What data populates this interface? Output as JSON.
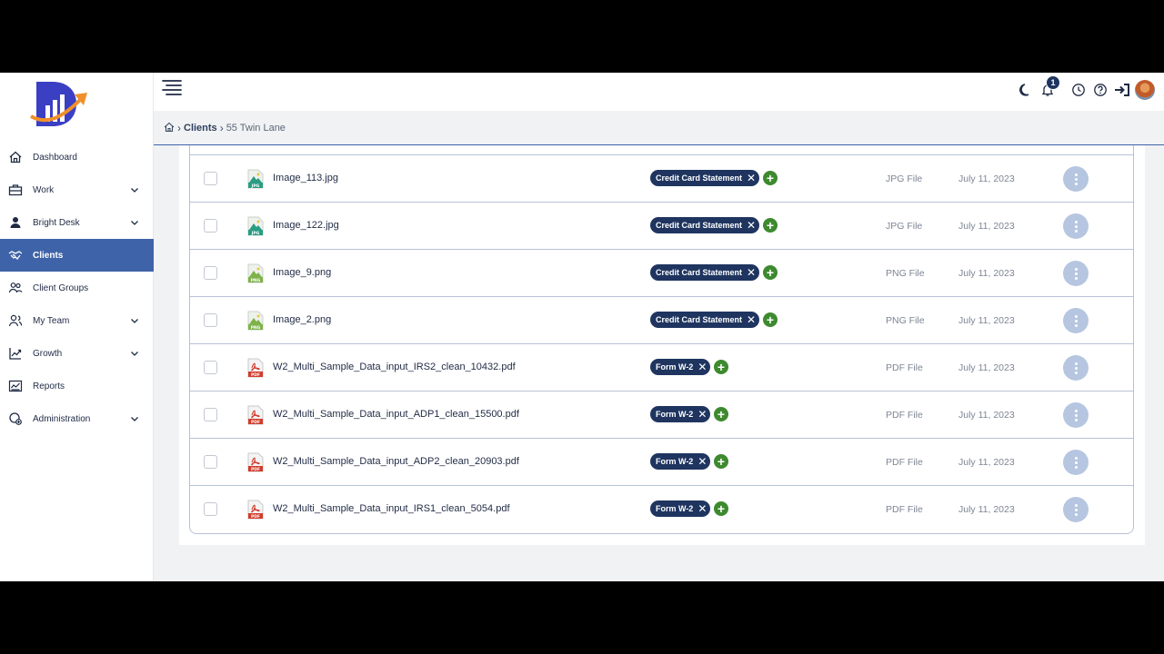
{
  "sidebar": {
    "items": [
      {
        "label": "Dashboard",
        "icon": "home-icon",
        "has_chevron": false,
        "active": false
      },
      {
        "label": "Work",
        "icon": "briefcase-icon",
        "has_chevron": true,
        "active": false
      },
      {
        "label": "Bright Desk",
        "icon": "user-desk-icon",
        "has_chevron": true,
        "active": false
      },
      {
        "label": "Clients",
        "icon": "handshake-icon",
        "has_chevron": false,
        "active": true
      },
      {
        "label": "Client Groups",
        "icon": "users-icon",
        "has_chevron": false,
        "active": false
      },
      {
        "label": "My Team",
        "icon": "team-icon",
        "has_chevron": true,
        "active": false
      },
      {
        "label": "Growth",
        "icon": "growth-chart-icon",
        "has_chevron": true,
        "active": false
      },
      {
        "label": "Reports",
        "icon": "report-icon",
        "has_chevron": false,
        "active": false
      },
      {
        "label": "Administration",
        "icon": "admin-icon",
        "has_chevron": true,
        "active": false
      }
    ]
  },
  "topbar": {
    "notification_count": "1",
    "icons": [
      "dark-mode-icon",
      "bell-icon",
      "clock-icon",
      "help-icon",
      "sign-in-icon",
      "user-avatar"
    ]
  },
  "breadcrumb": {
    "link": "Clients",
    "current": "55 Twin Lane"
  },
  "files": [
    {
      "name": "Image_113.jpg",
      "kind": "jpg",
      "tag": "Credit Card Statement",
      "type": "JPG File",
      "date": "July 11, 2023"
    },
    {
      "name": "Image_122.jpg",
      "kind": "jpg",
      "tag": "Credit Card Statement",
      "type": "JPG File",
      "date": "July 11, 2023"
    },
    {
      "name": "Image_9.png",
      "kind": "png",
      "tag": "Credit Card Statement",
      "type": "PNG File",
      "date": "July 11, 2023"
    },
    {
      "name": "Image_2.png",
      "kind": "png",
      "tag": "Credit Card Statement",
      "type": "PNG File",
      "date": "July 11, 2023"
    },
    {
      "name": "W2_Multi_Sample_Data_input_IRS2_clean_10432.pdf",
      "kind": "pdf",
      "tag": "Form W-2",
      "type": "PDF File",
      "date": "July 11, 2023"
    },
    {
      "name": "W2_Multi_Sample_Data_input_ADP1_clean_15500.pdf",
      "kind": "pdf",
      "tag": "Form W-2",
      "type": "PDF File",
      "date": "July 11, 2023"
    },
    {
      "name": "W2_Multi_Sample_Data_input_ADP2_clean_20903.pdf",
      "kind": "pdf",
      "tag": "Form W-2",
      "type": "PDF File",
      "date": "July 11, 2023"
    },
    {
      "name": "W2_Multi_Sample_Data_input_IRS1_clean_5054.pdf",
      "kind": "pdf",
      "tag": "Form W-2",
      "type": "PDF File",
      "date": "July 11, 2023"
    }
  ],
  "colors": {
    "accent": "#3f63a8",
    "tag_bg": "#1f3560",
    "add_green": "#3d8a2f",
    "action_button": "#b6c6e0"
  }
}
